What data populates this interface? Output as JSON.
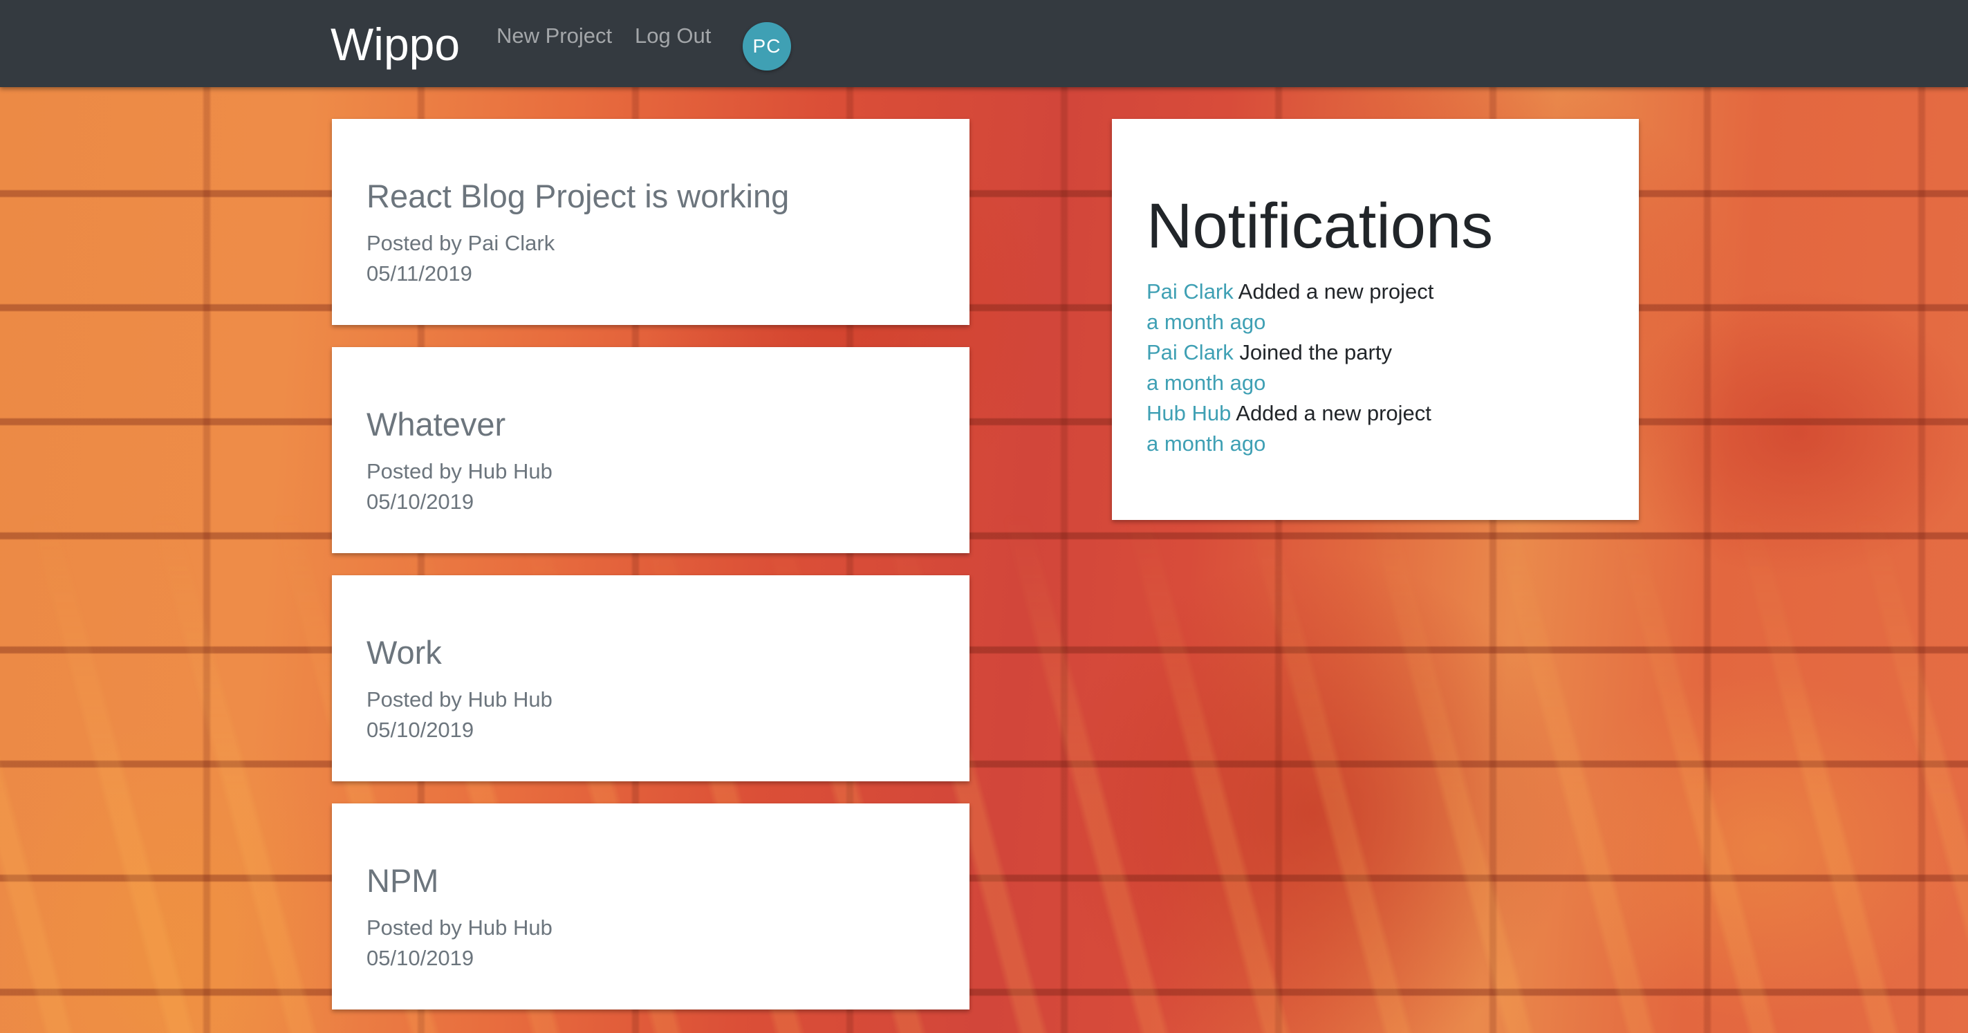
{
  "navbar": {
    "brand": "Wippo",
    "links": [
      {
        "label": "New Project"
      },
      {
        "label": "Log Out"
      }
    ],
    "avatar_initials": "PC",
    "background_color": "#343a40",
    "avatar_color": "#3fa0b4"
  },
  "projects": [
    {
      "title": "React Blog Project is working",
      "author": "Posted by Pai Clark",
      "date": "05/11/2019"
    },
    {
      "title": "Whatever",
      "author": "Posted by Hub Hub",
      "date": "05/10/2019"
    },
    {
      "title": "Work",
      "author": "Posted by Hub Hub",
      "date": "05/10/2019"
    },
    {
      "title": "NPM",
      "author": "Posted by Hub Hub",
      "date": "05/10/2019"
    }
  ],
  "notifications": {
    "title": "Notifications",
    "items": [
      {
        "user": "Pai Clark",
        "action": "Added a new project",
        "time": "a month ago"
      },
      {
        "user": "Pai Clark",
        "action": "Joined the party",
        "time": "a month ago"
      },
      {
        "user": "Hub Hub",
        "action": "Added a new project",
        "time": "a month ago"
      }
    ],
    "link_color": "#3fa0b4"
  }
}
